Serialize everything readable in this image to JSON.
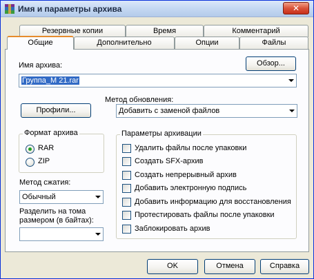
{
  "window": {
    "title": "Имя и параметры архива",
    "close_glyph": "✕"
  },
  "tabs_row1": [
    {
      "label": "Резервные копии"
    },
    {
      "label": "Время"
    },
    {
      "label": "Комментарий"
    }
  ],
  "tabs_row2": [
    {
      "label": "Общие",
      "active": true
    },
    {
      "label": "Дополнительно"
    },
    {
      "label": "Опции"
    },
    {
      "label": "Файлы"
    }
  ],
  "general": {
    "archive_name_label": "Имя архива:",
    "archive_name_value": "Группа_М 21.rar",
    "browse_button": "Обзор...",
    "update_method_label": "Метод обновления:",
    "update_method_value": "Добавить с заменой файлов",
    "profiles_button": "Профили...",
    "format_group_title": "Формат архива",
    "format_options": [
      {
        "label": "RAR",
        "selected": true
      },
      {
        "label": "ZIP",
        "selected": false
      }
    ],
    "compression_label": "Метод сжатия:",
    "compression_value": "Обычный",
    "split_label_line1": "Разделить на тома",
    "split_label_line2": "размером (в байтах):",
    "split_value": "",
    "options_group_title": "Параметры архивации",
    "options": [
      {
        "label": "Удалить файлы после упаковки",
        "checked": false
      },
      {
        "label": "Создать SFX-архив",
        "checked": false
      },
      {
        "label": "Создать непрерывный архив",
        "checked": false
      },
      {
        "label": "Добавить электронную подпись",
        "checked": false
      },
      {
        "label": "Добавить информацию для восстановления",
        "checked": false
      },
      {
        "label": "Протестировать файлы после упаковки",
        "checked": false
      },
      {
        "label": "Заблокировать архив",
        "checked": false
      }
    ]
  },
  "footer": {
    "ok": "OK",
    "cancel": "Отмена",
    "help": "Справка"
  },
  "colors": {
    "accent": "#e68b2c",
    "selection": "#316ac5",
    "radio_dot": "#21a121"
  }
}
